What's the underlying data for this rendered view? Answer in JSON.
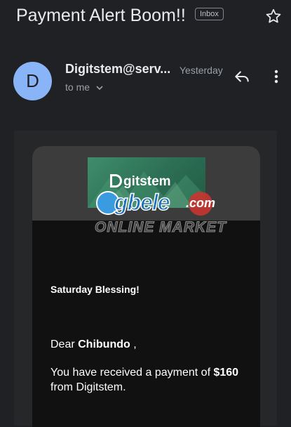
{
  "header": {
    "subject": "Payment Alert Boom!!",
    "label_chip": "Inbox",
    "star_icon": "star-outline-icon"
  },
  "message": {
    "avatar_letter": "D",
    "avatar_color": "#8ab4f8",
    "sender": "Digitstem@serv...",
    "date": "Yesterday",
    "recipient": "to me",
    "reply_icon": "reply-icon",
    "more_icon": "more-vert-icon"
  },
  "email_body": {
    "banner_brand": "gitstem",
    "watermark_logo": "gbele",
    "watermark_domain": ".com",
    "watermark_subtitle": "ONLINE MARKET",
    "heading": "Saturday Blessing!",
    "greeting_prefix": "Dear ",
    "recipient_name": "Chibundo",
    "greeting_suffix": " ,",
    "text_part1": "You have received a payment of ",
    "amount": "$160",
    "text_part2": " from Digitstem."
  }
}
